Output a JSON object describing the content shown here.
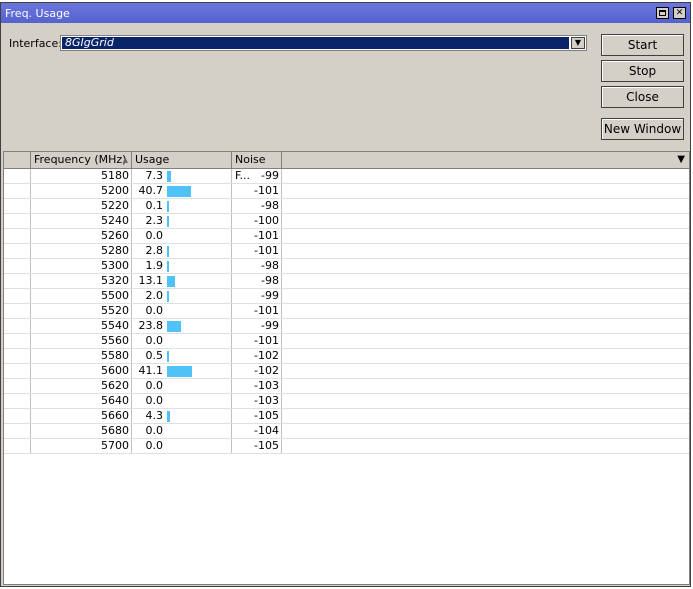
{
  "window": {
    "title": "Freq. Usage",
    "maximize_glyph": "",
    "close_glyph": "✕"
  },
  "interface": {
    "label": "Interface:",
    "value": "8GIgGrid",
    "arrow": "▼"
  },
  "buttons": {
    "start": "Start",
    "stop": "Stop",
    "close": "Close",
    "new_window": "New Window"
  },
  "table": {
    "columns": [
      "",
      "Frequency (MHz)",
      "Usage",
      "Noise F...",
      ""
    ],
    "sort_indicator": "▲",
    "menu_glyph": "▼",
    "usage_bar_color": "#4fc3f7",
    "rows": [
      {
        "freq": "5180",
        "usage": "7.3",
        "usage_fraction": 0.073,
        "noise": "-99"
      },
      {
        "freq": "5200",
        "usage": "40.7",
        "usage_fraction": 0.407,
        "noise": "-101"
      },
      {
        "freq": "5220",
        "usage": "0.1",
        "usage_fraction": 0.001,
        "noise": "-98"
      },
      {
        "freq": "5240",
        "usage": "2.3",
        "usage_fraction": 0.023,
        "noise": "-100"
      },
      {
        "freq": "5260",
        "usage": "0.0",
        "usage_fraction": 0.0,
        "noise": "-101"
      },
      {
        "freq": "5280",
        "usage": "2.8",
        "usage_fraction": 0.028,
        "noise": "-101"
      },
      {
        "freq": "5300",
        "usage": "1.9",
        "usage_fraction": 0.019,
        "noise": "-98"
      },
      {
        "freq": "5320",
        "usage": "13.1",
        "usage_fraction": 0.131,
        "noise": "-98"
      },
      {
        "freq": "5500",
        "usage": "2.0",
        "usage_fraction": 0.02,
        "noise": "-99"
      },
      {
        "freq": "5520",
        "usage": "0.0",
        "usage_fraction": 0.0,
        "noise": "-101"
      },
      {
        "freq": "5540",
        "usage": "23.8",
        "usage_fraction": 0.238,
        "noise": "-99"
      },
      {
        "freq": "5560",
        "usage": "0.0",
        "usage_fraction": 0.0,
        "noise": "-101"
      },
      {
        "freq": "5580",
        "usage": "0.5",
        "usage_fraction": 0.005,
        "noise": "-102"
      },
      {
        "freq": "5600",
        "usage": "41.1",
        "usage_fraction": 0.411,
        "noise": "-102"
      },
      {
        "freq": "5620",
        "usage": "0.0",
        "usage_fraction": 0.0,
        "noise": "-103"
      },
      {
        "freq": "5640",
        "usage": "0.0",
        "usage_fraction": 0.0,
        "noise": "-103"
      },
      {
        "freq": "5660",
        "usage": "4.3",
        "usage_fraction": 0.043,
        "noise": "-105"
      },
      {
        "freq": "5680",
        "usage": "0.0",
        "usage_fraction": 0.0,
        "noise": "-104"
      },
      {
        "freq": "5700",
        "usage": "0.0",
        "usage_fraction": 0.0,
        "noise": "-105"
      }
    ]
  }
}
